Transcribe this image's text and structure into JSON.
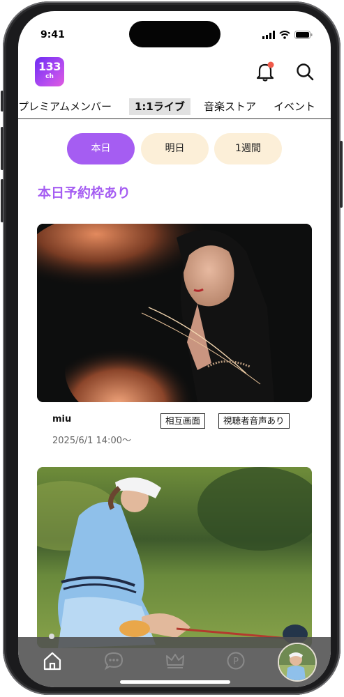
{
  "status_bar": {
    "time": "9:41"
  },
  "header": {
    "logo_number": "133",
    "logo_suffix": "ch"
  },
  "tabs": [
    {
      "label": "プレミアムメンバー"
    },
    {
      "label": "1:1ライブ",
      "active": true
    },
    {
      "label": "音楽ストア"
    },
    {
      "label": "イベント"
    }
  ],
  "filters": [
    {
      "label": "本日",
      "selected": true
    },
    {
      "label": "明日"
    },
    {
      "label": "1週間"
    }
  ],
  "section_title": "本日予約枠あり",
  "cards": [
    {
      "name": "miu",
      "datetime": "2025/6/1 14:00〜",
      "tags": [
        "相互画面",
        "視聴者音声あり"
      ]
    }
  ],
  "bottom_nav": {
    "items": [
      "home-icon",
      "chat-icon",
      "crown-icon",
      "points-icon",
      "profile-avatar"
    ],
    "points_symbol": "P"
  },
  "colors": {
    "accent": "#a55df2",
    "pill_inactive": "#fcefd8",
    "notification": "#f05a4a"
  }
}
